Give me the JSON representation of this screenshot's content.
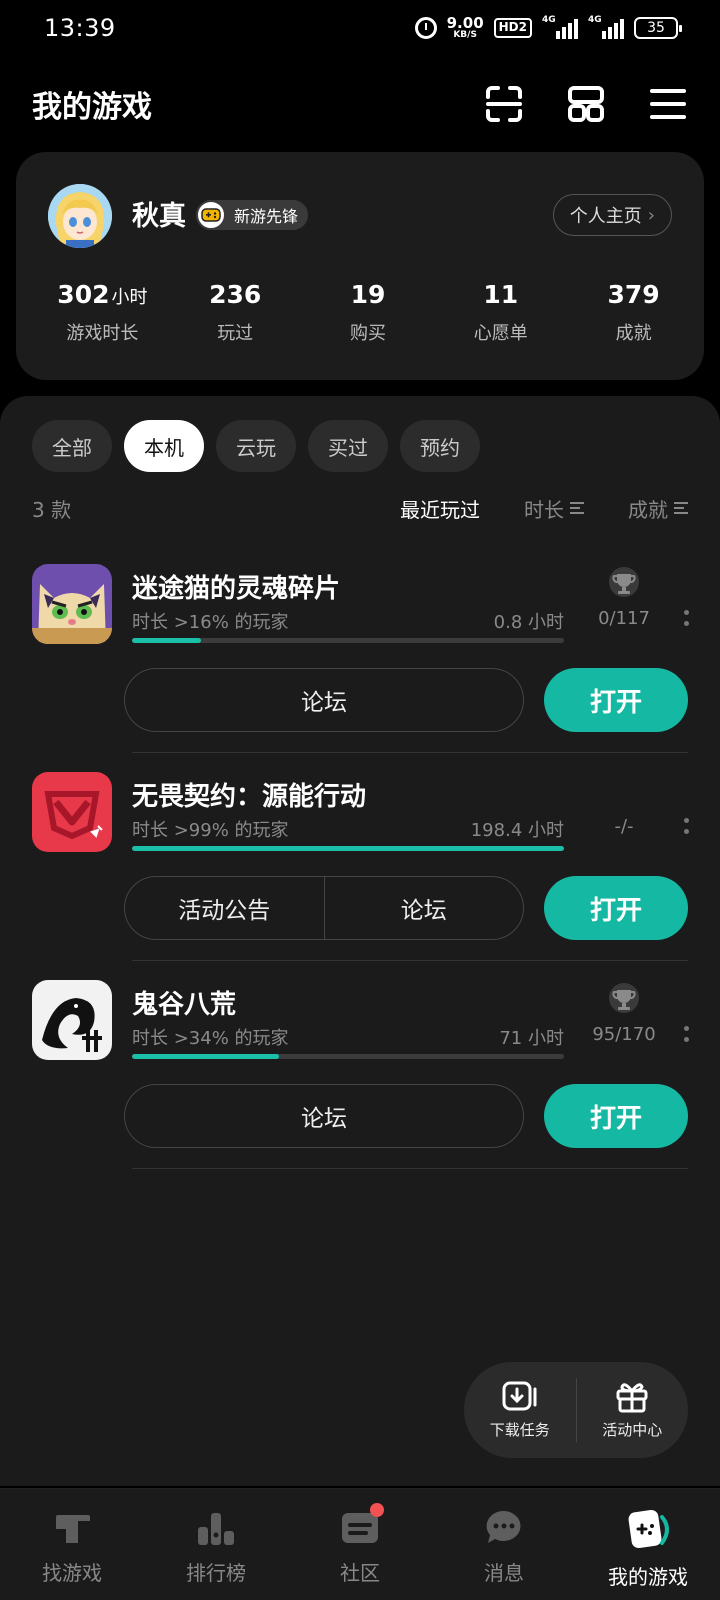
{
  "status_bar": {
    "time": "13:39",
    "net_speed_value": "9.00",
    "net_speed_unit": "KB/S",
    "hd_label": "HD2",
    "sim1_label": "4G",
    "sim2_label": "4G",
    "battery": "35"
  },
  "header": {
    "title": "我的游戏",
    "icons": [
      "scan-icon",
      "grid-icon",
      "menu-icon"
    ]
  },
  "profile": {
    "username": "秋真",
    "badge_label": "新游先锋",
    "homepage_label": "个人主页",
    "stats": [
      {
        "value": "302",
        "unit": "小时",
        "label": "游戏时长"
      },
      {
        "value": "236",
        "unit": "",
        "label": "玩过"
      },
      {
        "value": "19",
        "unit": "",
        "label": "购买"
      },
      {
        "value": "11",
        "unit": "",
        "label": "心愿单"
      },
      {
        "value": "379",
        "unit": "",
        "label": "成就"
      }
    ]
  },
  "tabs": [
    {
      "label": "全部",
      "active": false
    },
    {
      "label": "本机",
      "active": true
    },
    {
      "label": "云玩",
      "active": false
    },
    {
      "label": "买过",
      "active": false
    },
    {
      "label": "预约",
      "active": false
    }
  ],
  "sort": {
    "count": "3 款",
    "options": [
      {
        "label": "最近玩过",
        "active": true
      },
      {
        "label": "时长",
        "active": false
      },
      {
        "label": "成就",
        "active": false
      }
    ]
  },
  "games": [
    {
      "name": "迷途猫的灵魂碎片",
      "percent_text": "时长 >16% 的玩家",
      "hours": "0.8 小时",
      "progress": 0.16,
      "achievements": "0/117",
      "has_trophy": true,
      "actions": [
        "论坛"
      ],
      "open_label": "打开"
    },
    {
      "name": "无畏契约：源能行动",
      "percent_text": "时长 >99% 的玩家",
      "hours": "198.4 小时",
      "progress": 1.0,
      "achievements": "-/-",
      "has_trophy": false,
      "actions": [
        "活动公告",
        "论坛"
      ],
      "open_label": "打开"
    },
    {
      "name": "鬼谷八荒",
      "percent_text": "时长 >34% 的玩家",
      "hours": "71 小时",
      "progress": 0.34,
      "achievements": "95/170",
      "has_trophy": true,
      "actions": [
        "论坛"
      ],
      "open_label": "打开"
    }
  ],
  "quick_panel": {
    "download_label": "下载任务",
    "events_label": "活动中心"
  },
  "bottom_nav": [
    {
      "label": "找游戏",
      "icon": "discover-icon",
      "active": false
    },
    {
      "label": "排行榜",
      "icon": "ranking-icon",
      "active": false
    },
    {
      "label": "社区",
      "icon": "community-icon",
      "active": false,
      "dot": true
    },
    {
      "label": "消息",
      "icon": "message-icon",
      "active": false
    },
    {
      "label": "我的游戏",
      "icon": "my-games-icon",
      "active": true
    }
  ],
  "colors": {
    "accent": "#14b8a3",
    "background": "#000000",
    "panel": "#1b1b1b",
    "card": "#1c1c1c"
  }
}
